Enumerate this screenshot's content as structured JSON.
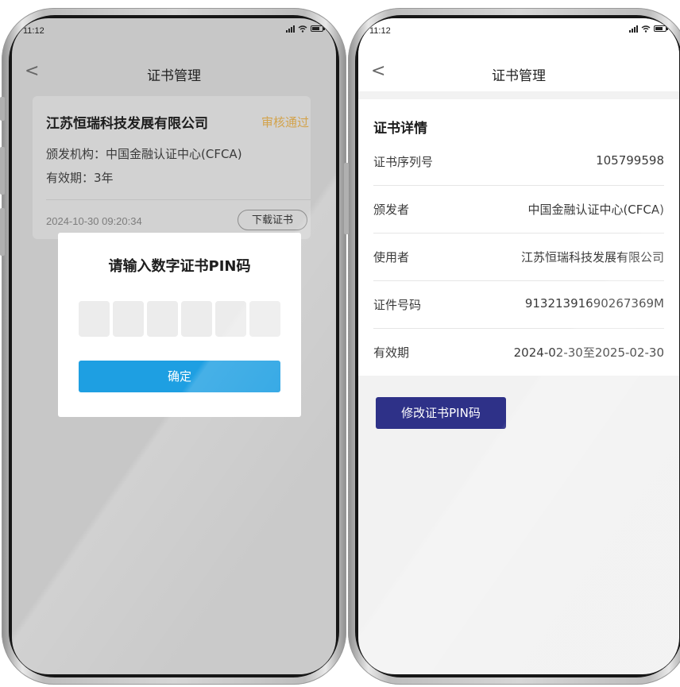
{
  "status_bar": {
    "time": "11:12"
  },
  "left": {
    "nav_title": "证书管理",
    "back_glyph": "<",
    "card": {
      "company": "江苏恒瑞科技发展有限公司",
      "status": "审核通过",
      "issuer_line": "颁发机构：中国金融认证中心(CFCA)",
      "validity_line": "有效期：3年",
      "datetime": "2024-10-30  09:20:34",
      "download_label": "下载证书"
    },
    "dialog": {
      "title": "请输入数字证书PIN码",
      "pin_length": 6,
      "confirm_label": "确定"
    }
  },
  "right": {
    "nav_title": "证书管理",
    "back_glyph": "<",
    "section_title": "证书详情",
    "rows": [
      {
        "key": "证书序列号",
        "value": "105799598"
      },
      {
        "key": "颁发者",
        "value": "中国金融认证中心(CFCA)"
      },
      {
        "key": "使用者",
        "value": "江苏恒瑞科技发展有限公司"
      },
      {
        "key": "证件号码",
        "value": "91321391690267369M"
      },
      {
        "key": "有效期",
        "value": "2024-02-30至2025-02-30"
      }
    ],
    "edit_pin_label": "修改证书PIN码"
  },
  "colors": {
    "status_approved": "#d3a34c",
    "confirm_button": "#1e9fe2",
    "edit_pin_button": "#2e3188"
  }
}
